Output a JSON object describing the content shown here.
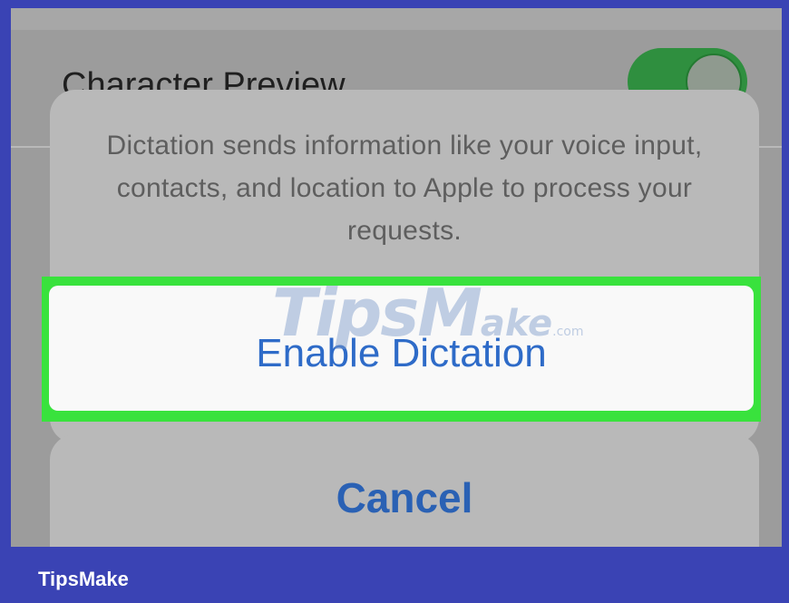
{
  "background": {
    "top_setting_label": "Character Preview",
    "bottom_setting_label": "",
    "toggle_color": "#2f8f3f"
  },
  "alert": {
    "message": "Dictation sends information like your voice input, contacts, and location to Apple to process your requests.",
    "primary_button": "Enable Dictation",
    "cancel_button": "Cancel",
    "highlight_color": "#39e23d"
  },
  "watermark": {
    "text_big": "Tips",
    "text_big2": "M",
    "text_small": "ake",
    "text_com": ".com"
  },
  "footer": {
    "brand": "TipsMake",
    "background_color": "#3a43b4"
  }
}
